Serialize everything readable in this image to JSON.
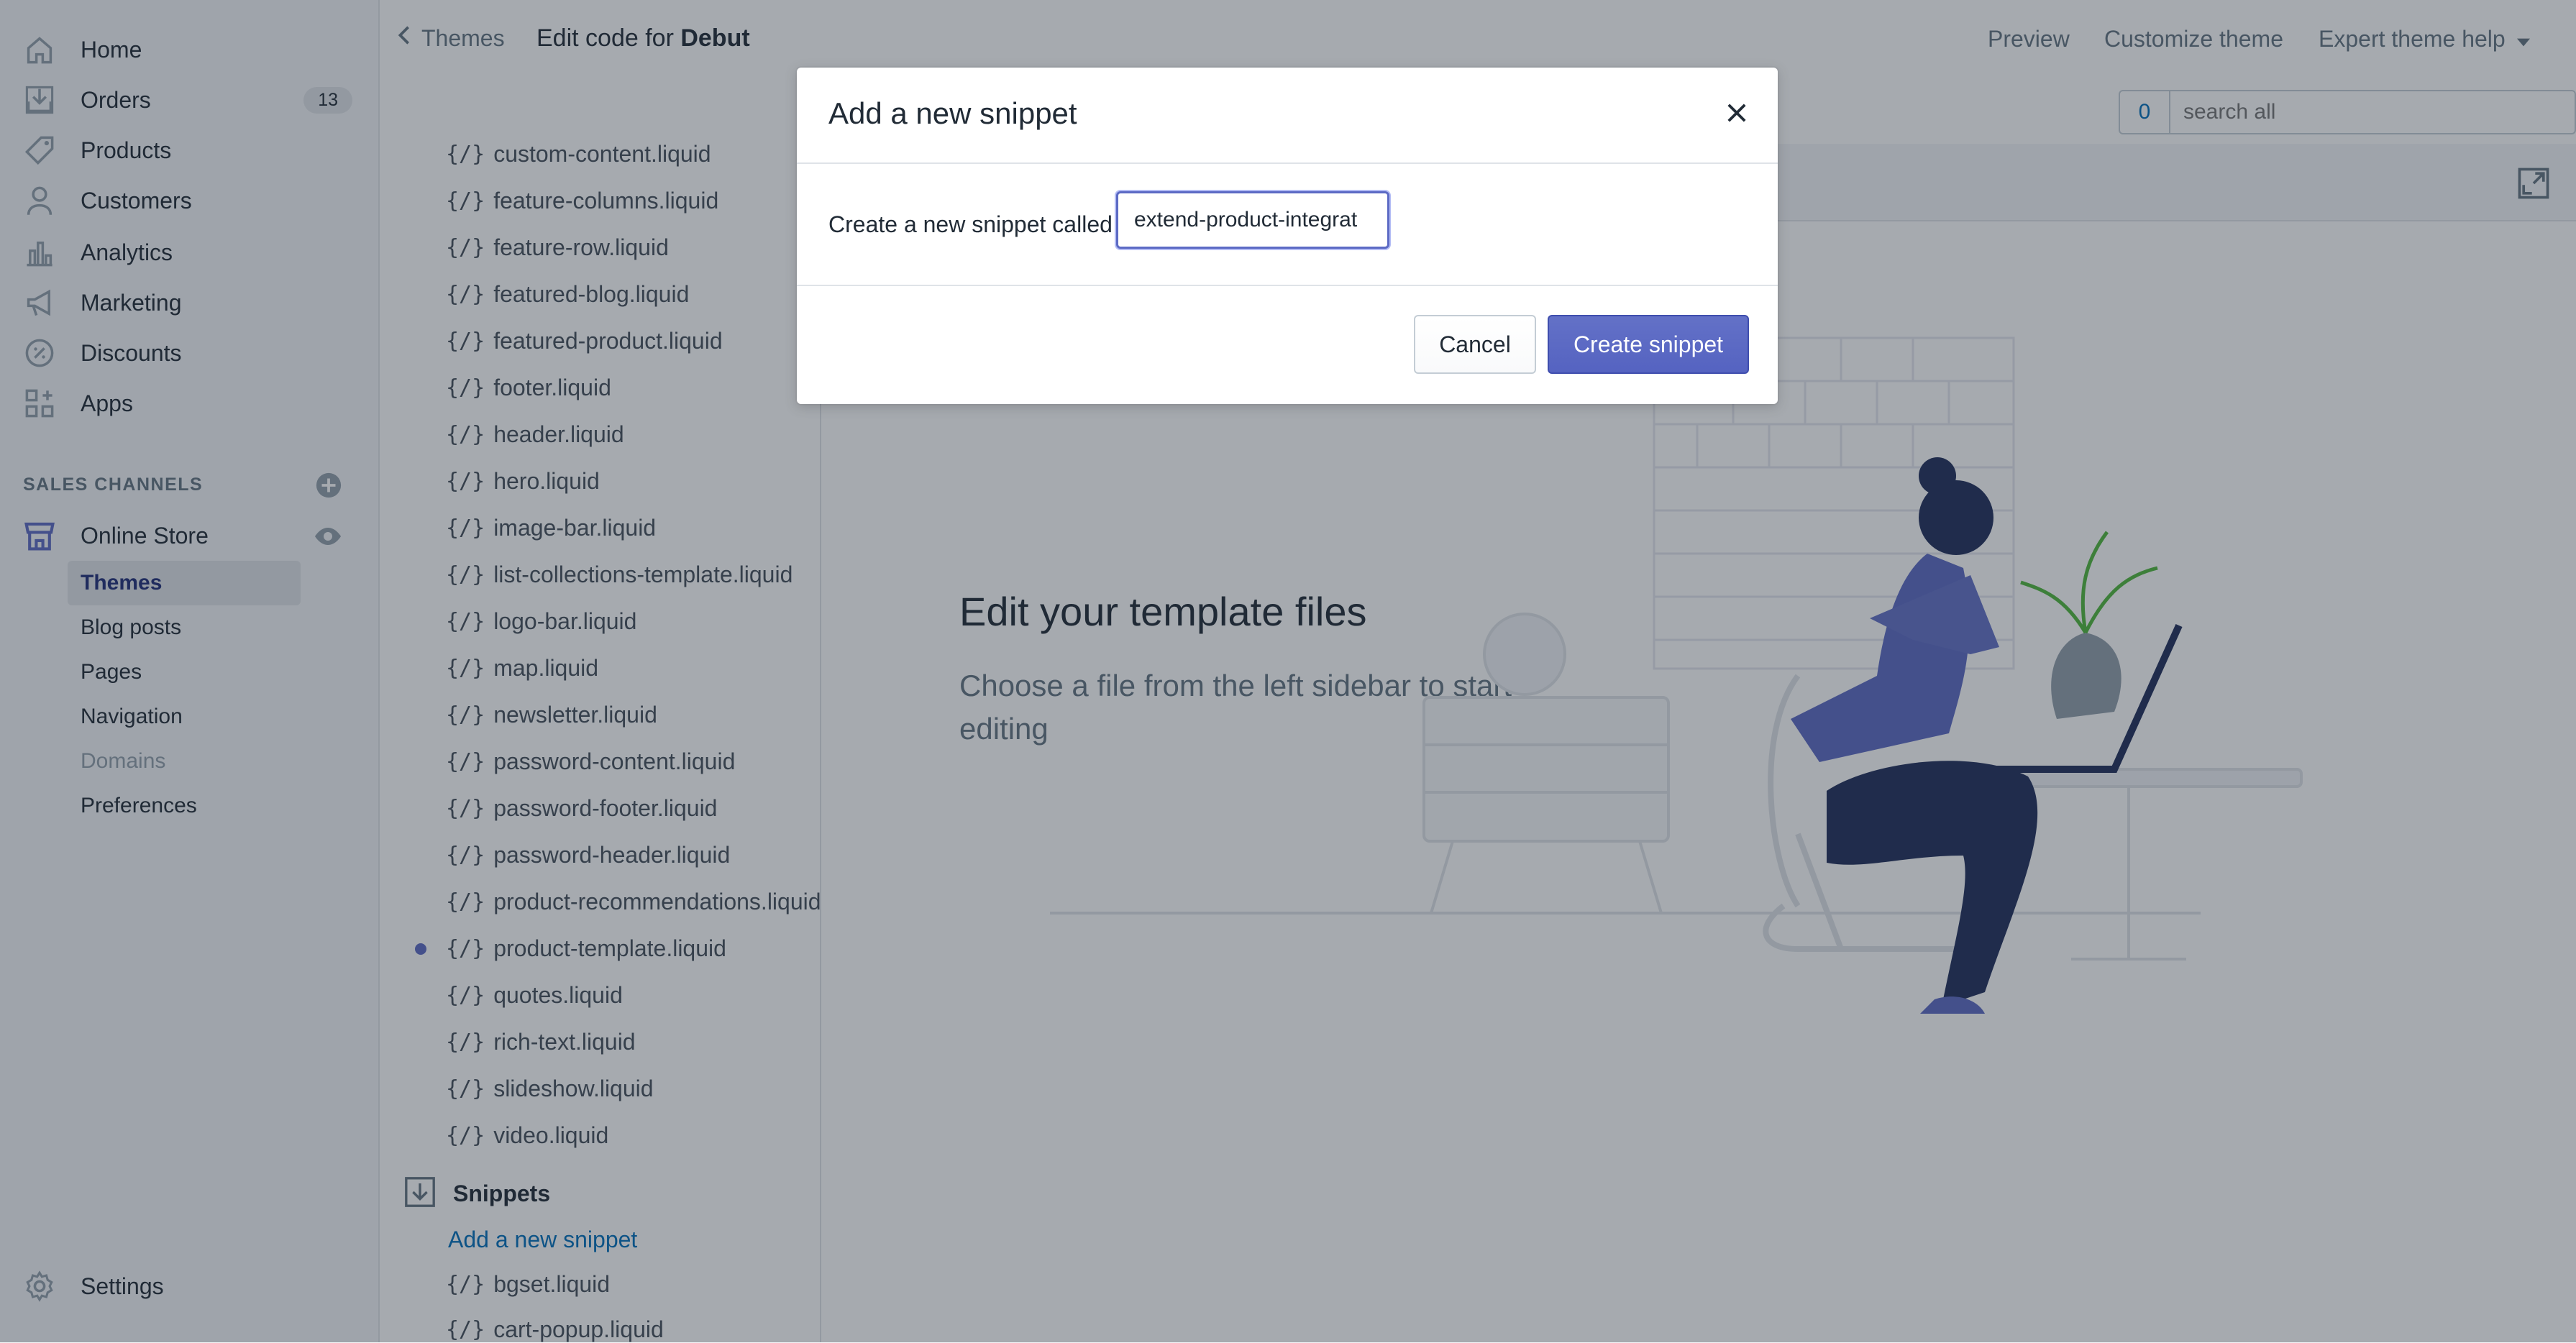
{
  "nav": {
    "items": [
      {
        "label": "Home",
        "icon": "home-icon"
      },
      {
        "label": "Orders",
        "icon": "orders-icon",
        "badge": "13"
      },
      {
        "label": "Products",
        "icon": "tag-icon"
      },
      {
        "label": "Customers",
        "icon": "person-icon"
      },
      {
        "label": "Analytics",
        "icon": "bar-chart-icon"
      },
      {
        "label": "Marketing",
        "icon": "megaphone-icon"
      },
      {
        "label": "Discounts",
        "icon": "discount-icon"
      },
      {
        "label": "Apps",
        "icon": "apps-icon"
      }
    ],
    "sales_channels_heading": "SALES CHANNELS",
    "online_store": "Online Store",
    "sub_items": [
      "Themes",
      "Blog posts",
      "Pages",
      "Navigation",
      "Domains",
      "Preferences"
    ],
    "settings": "Settings"
  },
  "topbar": {
    "back_label": "Themes",
    "title_prefix": "Edit code for",
    "theme_name": "Debut",
    "preview": "Preview",
    "customize": "Customize theme",
    "help": "Expert theme help",
    "search_count": "0",
    "search_placeholder": "search all"
  },
  "files": {
    "sections": [
      "custom-content.liquid",
      "feature-columns.liquid",
      "feature-row.liquid",
      "featured-blog.liquid",
      "featured-product.liquid",
      "footer.liquid",
      "header.liquid",
      "hero.liquid",
      "image-bar.liquid",
      "list-collections-template.liquid",
      "logo-bar.liquid",
      "map.liquid",
      "newsletter.liquid",
      "password-content.liquid",
      "password-footer.liquid",
      "password-header.liquid",
      "product-recommendations.liquid",
      "product-template.liquid",
      "quotes.liquid",
      "rich-text.liquid",
      "slideshow.liquid",
      "video.liquid"
    ],
    "file_icon_glyph": "{/}",
    "snippets_heading": "Snippets",
    "add_snippet": "Add a new snippet",
    "snippets": [
      "bgset.liquid",
      "cart-popup.liquid"
    ]
  },
  "main": {
    "headline": "Edit your template files",
    "subline": "Choose a file from the left sidebar to start editing"
  },
  "modal": {
    "title": "Add a new snippet",
    "label": "Create a new snippet called",
    "input_value": "extend-product-integrat",
    "cancel": "Cancel",
    "create": "Create snippet"
  },
  "colors": {
    "accent": "#5c6ac4",
    "link": "#006fbb",
    "nav_bg": "#f4f6f8"
  }
}
